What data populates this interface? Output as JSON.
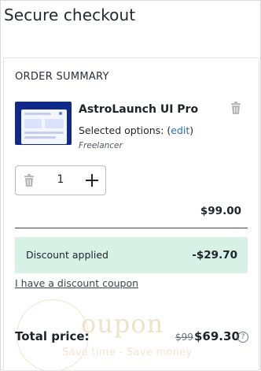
{
  "page": {
    "title": "Secure checkout"
  },
  "summary": {
    "heading": "ORDER SUMMARY",
    "product": {
      "title": "AstroLaunch UI Pro",
      "options_prefix": "Selected options: (",
      "options_link": "edit",
      "options_suffix": ")",
      "license": "Freelancer",
      "thumbnail_icon": "product-thumbnail"
    },
    "quantity": {
      "value": "1",
      "remove_icon": "trash-icon",
      "increase_icon": "plus-icon"
    },
    "remove_icon": "trash-icon",
    "subtotal": "$99.00",
    "discount": {
      "label": "Discount applied",
      "amount": "-$29.70"
    },
    "coupon_link": "I have a discount coupon",
    "total": {
      "label": "Total price:",
      "old_price": "$99",
      "new_price": "$69.30",
      "help_icon": "question-icon"
    }
  },
  "watermark": {
    "word": "oupon",
    "tagline": "Save time - Save money"
  },
  "colors": {
    "discount_bg": "#d7f1e6",
    "link": "#2271b1",
    "text": "#1f2328"
  }
}
